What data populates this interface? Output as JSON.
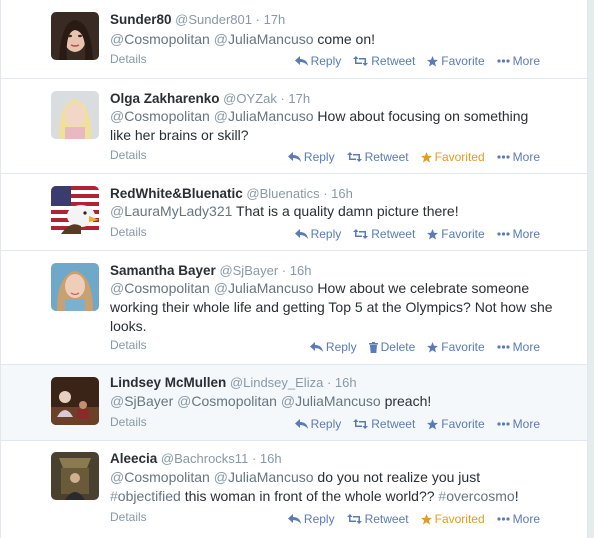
{
  "tweets": [
    {
      "fullname": "Sunder80",
      "username": "@Sunder801",
      "time": "17h",
      "text_parts": [
        {
          "type": "mention",
          "text": "Cosmopolitan"
        },
        {
          "type": "text",
          "text": " "
        },
        {
          "type": "mention",
          "text": "JuliaMancuso"
        },
        {
          "type": "text",
          "text": " come on!"
        }
      ],
      "details": "Details",
      "actions": {
        "reply": "Reply",
        "middle": "Retweet",
        "favorite": "Favorite",
        "more": "More"
      },
      "favorited": false
    },
    {
      "fullname": "Olga Zakharenko",
      "username": "@OYZak",
      "time": "17h",
      "text_parts": [
        {
          "type": "mention",
          "text": "Cosmopolitan"
        },
        {
          "type": "text",
          "text": " "
        },
        {
          "type": "mention",
          "text": "JuliaMancuso"
        },
        {
          "type": "text",
          "text": " How about focusing on something like her brains or skill?"
        }
      ],
      "details": "Details",
      "actions": {
        "reply": "Reply",
        "middle": "Retweet",
        "favorite": "Favorited",
        "more": "More"
      },
      "favorited": true
    },
    {
      "fullname": "RedWhite&Bluenatic",
      "username": "@Bluenatics",
      "time": "16h",
      "text_parts": [
        {
          "type": "mention",
          "text": "LauraMyLady321"
        },
        {
          "type": "text",
          "text": " That is a quality damn picture there!"
        }
      ],
      "details": "Details",
      "actions": {
        "reply": "Reply",
        "middle": "Retweet",
        "favorite": "Favorite",
        "more": "More"
      },
      "favorited": false
    },
    {
      "fullname": "Samantha Bayer",
      "username": "@SjBayer",
      "time": "16h",
      "text_parts": [
        {
          "type": "mention",
          "text": "Cosmopolitan"
        },
        {
          "type": "text",
          "text": " "
        },
        {
          "type": "mention",
          "text": "JuliaMancuso"
        },
        {
          "type": "text",
          "text": " How about we celebrate someone working their whole life and getting Top 5 at the Olympics? Not how she looks."
        }
      ],
      "details": "Details",
      "actions": {
        "reply": "Reply",
        "middle": "Delete",
        "favorite": "Favorite",
        "more": "More"
      },
      "favorited": false
    },
    {
      "fullname": "Lindsey McMullen",
      "username": "@Lindsey_Eliza",
      "time": "16h",
      "text_parts": [
        {
          "type": "mention",
          "text": "SjBayer"
        },
        {
          "type": "text",
          "text": " "
        },
        {
          "type": "mention",
          "text": "Cosmopolitan"
        },
        {
          "type": "text",
          "text": " "
        },
        {
          "type": "mention",
          "text": "JuliaMancuso"
        },
        {
          "type": "text",
          "text": " preach!"
        }
      ],
      "details": "Details",
      "actions": {
        "reply": "Reply",
        "middle": "Retweet",
        "favorite": "Favorite",
        "more": "More"
      },
      "favorited": false
    },
    {
      "fullname": "Aleecia",
      "username": "@Bachrocks11",
      "time": "16h",
      "text_parts": [
        {
          "type": "mention",
          "text": "Cosmopolitan"
        },
        {
          "type": "text",
          "text": " "
        },
        {
          "type": "mention",
          "text": "JuliaMancuso"
        },
        {
          "type": "text",
          "text": " do you not realize you just "
        },
        {
          "type": "hashtag",
          "text": "objectified"
        },
        {
          "type": "text",
          "text": " this woman in front of the whole world?? "
        },
        {
          "type": "hashtag",
          "text": "overcosmo"
        },
        {
          "type": "text",
          "text": "!"
        }
      ],
      "details": "Details",
      "actions": {
        "reply": "Reply",
        "middle": "Retweet",
        "favorite": "Favorited",
        "more": "More"
      },
      "favorited": true
    }
  ],
  "colors": {
    "action": "#5a7bb5",
    "favorited": "#e49c25",
    "meta": "#8899a6",
    "text": "#292f33",
    "highlight_row": "#f5f8fa"
  }
}
